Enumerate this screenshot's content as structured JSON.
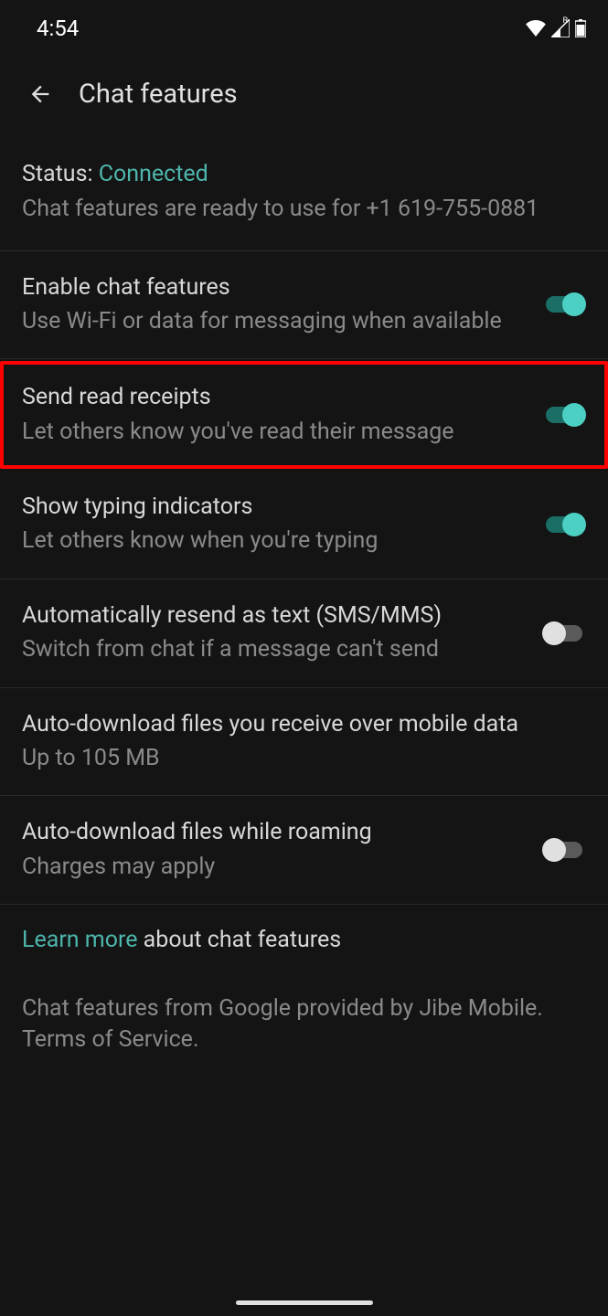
{
  "statusBar": {
    "time": "4:54"
  },
  "header": {
    "title": "Chat features"
  },
  "status": {
    "label": "Status:",
    "value": "Connected",
    "description": "Chat features are ready to use for +1 619-755-0881"
  },
  "settings": [
    {
      "title": "Enable chat features",
      "description": "Use Wi-Fi or data for messaging when available",
      "toggle": true,
      "highlighted": false
    },
    {
      "title": "Send read receipts",
      "description": "Let others know you've read their message",
      "toggle": true,
      "highlighted": true
    },
    {
      "title": "Show typing indicators",
      "description": "Let others know when you're typing",
      "toggle": true,
      "highlighted": false
    },
    {
      "title": "Automatically resend as text (SMS/MMS)",
      "description": "Switch from chat if a message can't send",
      "toggle": false,
      "highlighted": false
    },
    {
      "title": "Auto-download files you receive over mobile data",
      "description": "Up to 105 MB",
      "toggle": null,
      "highlighted": false
    },
    {
      "title": "Auto-download files while roaming",
      "description": "Charges may apply",
      "toggle": false,
      "highlighted": false
    }
  ],
  "footer": {
    "learnMoreLink": "Learn more",
    "learnMoreRest": " about chat features",
    "provider": "Chat features from Google provided by Jibe Mobile. Terms of Service."
  }
}
